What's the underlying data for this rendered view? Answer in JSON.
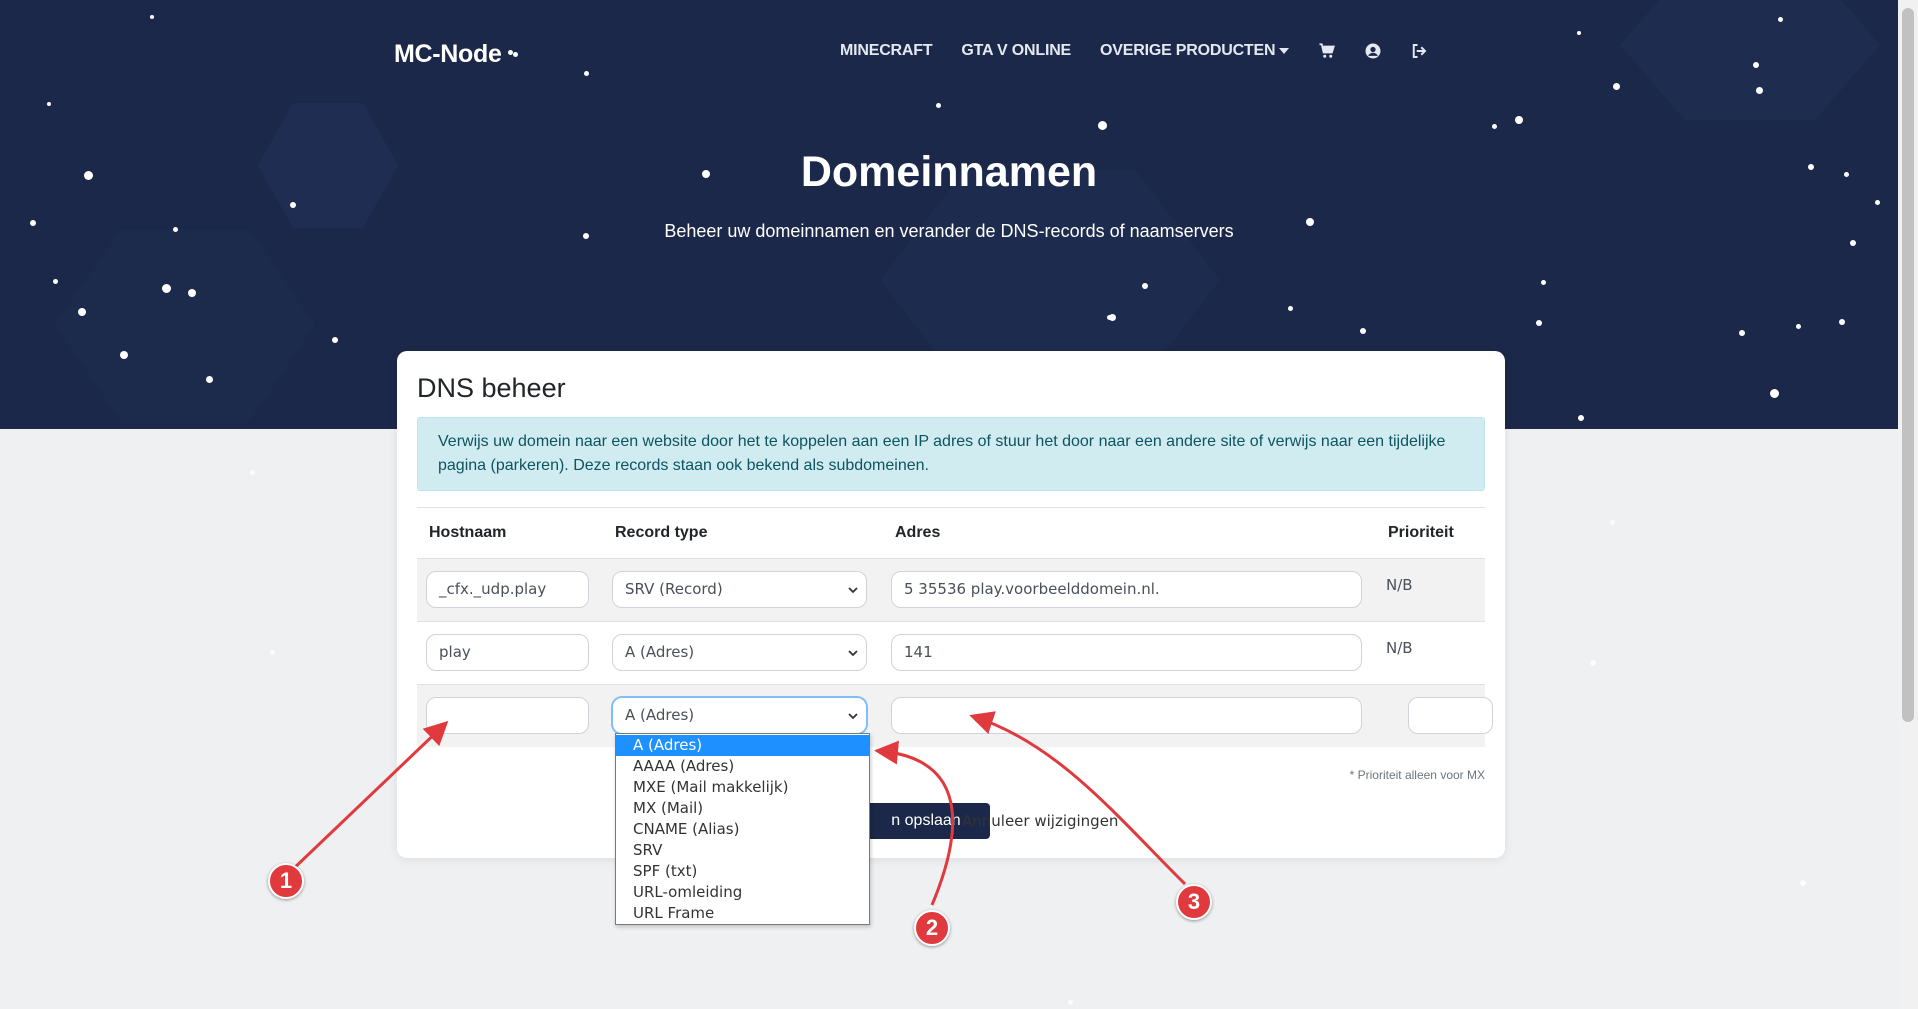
{
  "nav": {
    "brand": "MC-Node",
    "links": [
      "MINECRAFT",
      "GTA V ONLINE",
      "OVERIGE PRODUCTEN"
    ],
    "icons": [
      "cart-icon",
      "user-icon",
      "logout-icon"
    ]
  },
  "hero": {
    "title": "Domeinnamen",
    "subtitle": "Beheer uw domeinnamen en verander de DNS-records of naamservers"
  },
  "card": {
    "title": "DNS beheer",
    "info": "Verwijs uw domein naar een website door het te koppelen aan een IP adres of stuur het door naar een andere site of verwijs naar een tijdelijke pagina (parkeren). Deze records staan ook bekend als subdomeinen."
  },
  "table": {
    "headers": [
      "Hostnaam",
      "Record type",
      "Adres",
      "Prioriteit"
    ],
    "rows": [
      {
        "host": "_cfx._udp.play",
        "type": "SRV (Record)",
        "address": "5 35536 play.voorbeelddomein.nl.",
        "priority": "N/B"
      },
      {
        "host": "play",
        "type": "A (Adres)",
        "address": "141",
        "priority": "N/B"
      },
      {
        "host": "",
        "type": "A (Adres)",
        "address": "",
        "priority": ""
      }
    ]
  },
  "footer": {
    "note": "* Prioriteit alleen voor MX",
    "save_label": "n opslaan",
    "cancel_label": "Annuleer wijzigingen"
  },
  "dropdown": {
    "options": [
      "A (Adres)",
      "AAAA (Adres)",
      "MXE (Mail makkelijk)",
      "MX (Mail)",
      "CNAME (Alias)",
      "SRV",
      "SPF (txt)",
      "URL-omleiding",
      "URL Frame"
    ],
    "selected": "A (Adres)"
  },
  "annotations": [
    "1",
    "2",
    "3"
  ],
  "colors": {
    "hero": "#1b2849",
    "accent": "#1e90ff",
    "annotation": "#e03a3e",
    "alert_bg": "#d1ecf1"
  }
}
